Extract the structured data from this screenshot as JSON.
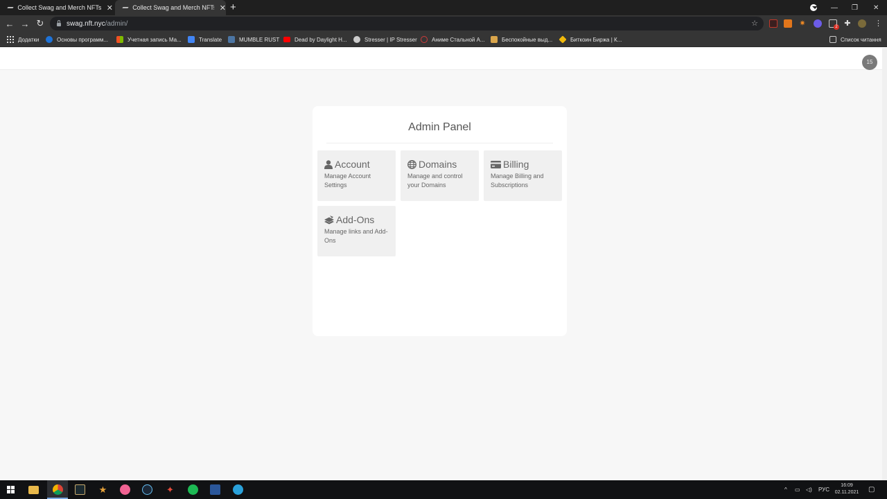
{
  "browser": {
    "tabs": [
      {
        "title": "Collect Swag and Merch NFTs | N",
        "active": false
      },
      {
        "title": "Collect Swag and Merch NFTs | N",
        "active": true
      }
    ],
    "new_tab_label": "+",
    "window_controls": {
      "minimize": "—",
      "restore": "❐",
      "close": "✕"
    },
    "url": {
      "host": "swag.nft.nyc",
      "path": "/admin/"
    },
    "bookmarks": [
      {
        "label": "Додатки",
        "icon": "apps-grid-icon",
        "color": "#dddddd"
      },
      {
        "label": "Основы программ...",
        "icon": "c-logo-icon",
        "color": "#1e73d8"
      },
      {
        "label": "Учетная запись Ма...",
        "icon": "microsoft-logo-icon",
        "color": "#f25022"
      },
      {
        "label": "Translate",
        "icon": "translate-icon",
        "color": "#4285f4"
      },
      {
        "label": "MUMBLE RUST",
        "icon": "vk-icon",
        "color": "#4c75a3"
      },
      {
        "label": "Dead by Daylight H...",
        "icon": "youtube-icon",
        "color": "#ff0000"
      },
      {
        "label": "Stresser | IP Stresser",
        "icon": "globe-icon",
        "color": "#cccccc"
      },
      {
        "label": "Аниме Стальной А...",
        "icon": "anime-site-icon",
        "color": "#d23b3b"
      },
      {
        "label": "Беспокойные выд...",
        "icon": "bookmark-site-icon",
        "color": "#d9a54b"
      },
      {
        "label": "Биткоин Биржа | К...",
        "icon": "binance-icon",
        "color": "#f0b90b"
      }
    ],
    "reading_list_label": "Список читання",
    "extension_badge": "2"
  },
  "page": {
    "notification_count": "15",
    "panel": {
      "title": "Admin Panel",
      "cards": [
        {
          "title": "Account",
          "description": "Manage Account Settings",
          "icon": "user-icon"
        },
        {
          "title": "Domains",
          "description": "Manage and control your Domains",
          "icon": "globe-icon"
        },
        {
          "title": "Billing",
          "description": "Manage Billing and Subscriptions",
          "icon": "credit-card-icon"
        },
        {
          "title": "Add-Ons",
          "description": "Manage links and Add-Ons",
          "icon": "layers-icon"
        }
      ]
    }
  },
  "taskbar": {
    "language": "РУС",
    "time": "16:09",
    "date": "02.11.2021"
  },
  "colors": {
    "page_bg": "#f7f7f7",
    "card_bg": "#f0f0f0",
    "text": "#666666",
    "browser_dark": "#353535"
  }
}
